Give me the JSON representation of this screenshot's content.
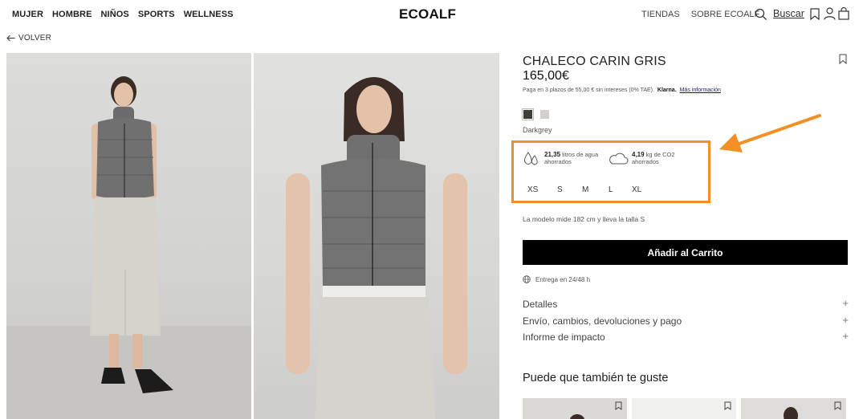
{
  "header": {
    "nav_left": [
      "MUJER",
      "HOMBRE",
      "NIÑOS",
      "SPORTS",
      "WELLNESS"
    ],
    "logo": "ECOALF",
    "nav_right": [
      "TIENDAS",
      "SOBRE ECOALF"
    ],
    "search_label": "Buscar"
  },
  "back_label": "VOLVER",
  "product": {
    "name": "CHALECO CARIN GRIS",
    "price": "165,00€",
    "klarna_text": "Paga en 3 plazos de 55,00 € sin intereses (0% TAE).",
    "klarna_brand": "Klarna.",
    "klarna_more": "Más información",
    "color_name": "Darkgrey",
    "swatches": [
      {
        "color": "#3d3f36"
      },
      {
        "color": "#d3d0cb"
      }
    ],
    "impact": {
      "water_value": "21,35",
      "water_text": "litros de agua ahorrados",
      "co2_value": "4,19",
      "co2_text": "kg de CO2 ahorrados"
    },
    "sizes": [
      "XS",
      "S",
      "M",
      "L",
      "XL"
    ],
    "model_note": "La modelo mide 182 cm y lleva la talla S",
    "add_to_cart": "Añadir al Carrito",
    "delivery": "Entrega en 24/48 h",
    "accordions": [
      "Detalles",
      "Envío, cambios, devoluciones y pago",
      "Informe de impacto"
    ],
    "recommend_title": "Puede que también te guste"
  },
  "accent_color": "#f29026"
}
